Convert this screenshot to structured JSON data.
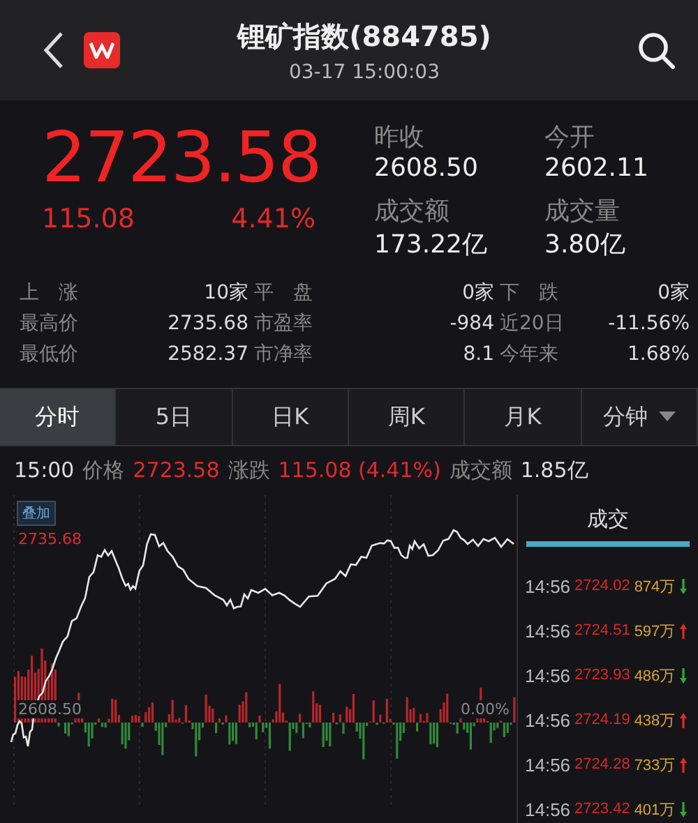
{
  "header": {
    "title": "锂矿指数(884785)",
    "subtitle": "03-17 15:00:03"
  },
  "quote": {
    "price": "2723.58",
    "change": "115.08",
    "change_pct": "4.41%",
    "fields": [
      {
        "label": "昨收",
        "value": "2608.50"
      },
      {
        "label": "今开",
        "value": "2602.11"
      },
      {
        "label": "成交额",
        "value": "173.22亿"
      },
      {
        "label": "成交量",
        "value": "3.80亿"
      }
    ]
  },
  "stats": [
    [
      {
        "label": "上　涨",
        "value": "10家"
      },
      {
        "label": "平　盘",
        "value": "0家"
      },
      {
        "label": "下　跌",
        "value": "0家"
      }
    ],
    [
      {
        "label": "最高价",
        "value": "2735.68"
      },
      {
        "label": "市盈率",
        "value": "-984"
      },
      {
        "label": "近20日",
        "value": "-11.56%"
      }
    ],
    [
      {
        "label": "最低价",
        "value": "2582.37"
      },
      {
        "label": "市净率",
        "value": "8.1"
      },
      {
        "label": "今年来",
        "value": "1.68%"
      }
    ]
  ],
  "tabs": [
    {
      "label": "分时",
      "selected": true
    },
    {
      "label": "5日",
      "selected": false
    },
    {
      "label": "日K",
      "selected": false
    },
    {
      "label": "周K",
      "selected": false
    },
    {
      "label": "月K",
      "selected": false
    },
    {
      "label": "分钟",
      "selected": false,
      "dropdown": true
    }
  ],
  "info_line": [
    {
      "label": "15:00",
      "kind": "time"
    },
    {
      "label": "价格",
      "kind": "label"
    },
    {
      "label": "2723.58",
      "kind": "up"
    },
    {
      "label": "涨跌",
      "kind": "label"
    },
    {
      "label": "115.08 (4.41%)",
      "kind": "up"
    },
    {
      "label": "成交额",
      "kind": "label"
    },
    {
      "label": "1.85亿",
      "kind": "time"
    }
  ],
  "chart": {
    "overlay_button": "叠加",
    "high_label": "2735.68",
    "base_label": "2608.50",
    "base_pct": "0.00%"
  },
  "trades": {
    "title": "成交",
    "rows": [
      {
        "time": "14:56",
        "price": "2724.02",
        "volume": "874万",
        "up": false
      },
      {
        "time": "14:56",
        "price": "2724.51",
        "volume": "597万",
        "up": true
      },
      {
        "time": "14:56",
        "price": "2723.93",
        "volume": "486万",
        "up": false
      },
      {
        "time": "14:56",
        "price": "2724.19",
        "volume": "438万",
        "up": true
      },
      {
        "time": "14:56",
        "price": "2724.28",
        "volume": "733万",
        "up": true
      },
      {
        "time": "14:56",
        "price": "2723.42",
        "volume": "401万",
        "up": false
      }
    ]
  }
}
